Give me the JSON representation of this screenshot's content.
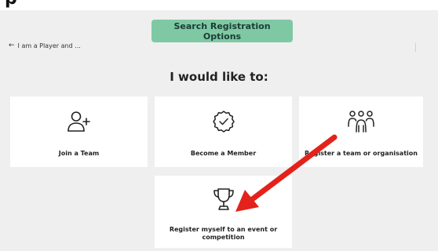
{
  "page": {
    "top_fragment": "p"
  },
  "search_button": {
    "label": "Search Registration Options"
  },
  "back_link": {
    "arrow": "←",
    "label": "I am a Player and ..."
  },
  "heading": "I would like to:",
  "cards": {
    "join": {
      "label": "Join a Team",
      "icon": "add-user-icon"
    },
    "member": {
      "label": "Become a Member",
      "icon": "badge-check-icon"
    },
    "team": {
      "label": "Register a team or organisation",
      "icon": "group-icon"
    },
    "event": {
      "label": "Register myself to an event or competition",
      "icon": "trophy-icon"
    }
  },
  "colors": {
    "background": "#efefef",
    "card": "#ffffff",
    "accent": "#7ec9a4",
    "annotation": "#e3221b"
  }
}
